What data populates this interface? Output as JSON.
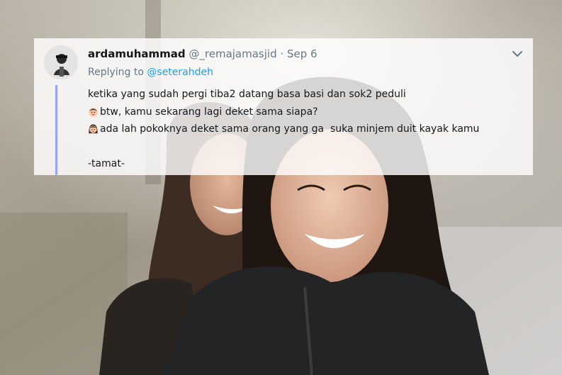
{
  "tweet": {
    "display_name": "ardamuhammad",
    "handle": "@_remajamasjid",
    "separator": "·",
    "date": "Sep 6",
    "replying_prefix": "Replying to",
    "replying_to": "@seterahdeh",
    "lines": [
      "ketika yang sudah pergi tiba2 datang basa basi dan sok2 peduli",
      "btw, kamu sekarang lagi deket sama siapa?",
      "ada lah pokoknya deket sama orang yang ga  suka minjem duit kayak kamu",
      "",
      "-tamat-"
    ],
    "emojis": [
      "boy-face-emoji",
      "woman-face-emoji"
    ],
    "icons": [
      "chevron-down-icon"
    ]
  },
  "colors": {
    "mention": "#1da1f2",
    "thread_line": "#9aa0ff",
    "muted": "#657786"
  }
}
